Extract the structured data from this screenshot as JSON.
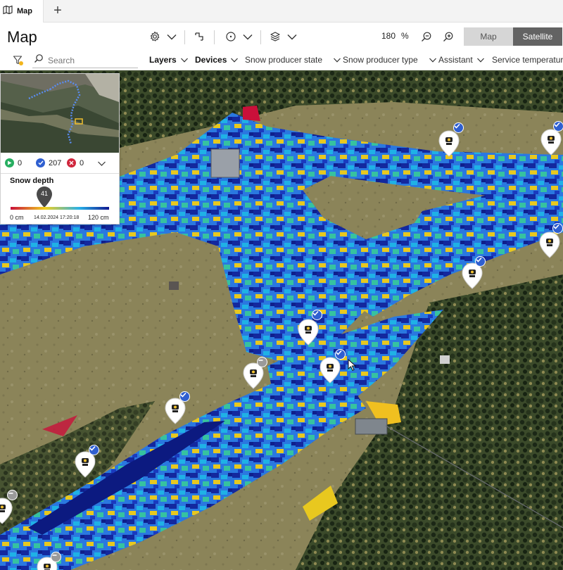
{
  "tab": {
    "label": "Map",
    "icon": "map-icon",
    "add_icon": "plus-icon"
  },
  "header": {
    "title": "Map",
    "icons": [
      "gear-icon",
      "route-icon",
      "timer-icon",
      "layers-icon",
      "zoom-out-icon",
      "zoom-in-icon"
    ],
    "zoom_value": "180",
    "zoom_unit": "%",
    "view_toggle": {
      "map_label": "Map",
      "satellite_label": "Satellite",
      "selected": "Satellite"
    }
  },
  "filterbar": {
    "search_placeholder": "Search",
    "filters": [
      {
        "label": "Layers",
        "bold": true
      },
      {
        "label": "Devices",
        "bold": true
      },
      {
        "label": "Snow producer state",
        "bold": false
      },
      {
        "label": "Snow producer type",
        "bold": false
      },
      {
        "label": "Assistant",
        "bold": false
      },
      {
        "label": "Service temperature",
        "bold": false
      }
    ]
  },
  "overview": {
    "status": [
      {
        "icon": "play-icon",
        "count": "0",
        "color": "#27ae60"
      },
      {
        "icon": "check-icon",
        "count": "207",
        "color": "#2f5fd0"
      },
      {
        "icon": "close-icon",
        "count": "0",
        "color": "#d0263c"
      }
    ],
    "legend": {
      "title": "Snow depth",
      "value": "41",
      "min_label": "0 cm",
      "max_label": "120 cm",
      "timestamp": "14.02.2024 17:20:18",
      "gradient": [
        "#c9103a",
        "#f0d020",
        "#28b0e8",
        "#101890"
      ]
    }
  },
  "colors": {
    "accent": "#2f5fd0",
    "terrain": "#8a8258",
    "forest": "#23301e",
    "snow_low": "#e8c22a",
    "snow_mid": "#24a8e0",
    "snow_high": "#10249a"
  },
  "markers": [
    {
      "type": "snow-gun",
      "state": "ready"
    },
    {
      "type": "snow-gun",
      "state": "ready"
    },
    {
      "type": "snow-gun",
      "state": "ready"
    },
    {
      "type": "snow-gun",
      "state": "ready"
    },
    {
      "type": "snow-gun",
      "state": "ready"
    },
    {
      "type": "snow-gun",
      "state": "ready"
    },
    {
      "type": "snow-gun",
      "state": "standby"
    },
    {
      "type": "snow-gun",
      "state": "ready"
    },
    {
      "type": "snow-gun",
      "state": "ready"
    },
    {
      "type": "snow-gun",
      "state": "standby"
    },
    {
      "type": "snow-gun",
      "state": "standby"
    }
  ]
}
